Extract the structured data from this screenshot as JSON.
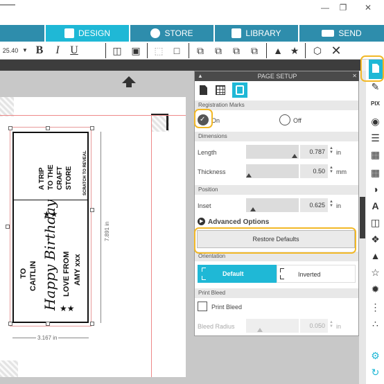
{
  "nav": {
    "tabs": [
      {
        "label": "DESIGN",
        "icon": "grid-icon",
        "active": true
      },
      {
        "label": "STORE",
        "icon": "store-icon",
        "active": false
      },
      {
        "label": "LIBRARY",
        "icon": "library-icon",
        "active": false
      },
      {
        "label": "SEND",
        "icon": "send-icon",
        "active": false
      }
    ]
  },
  "toolbar": {
    "font_size": "25.40",
    "bold": "B",
    "italic": "I",
    "underline": "U"
  },
  "panel": {
    "title": "PAGE SETUP",
    "registration_marks": {
      "section": "Registration Marks",
      "on_label": "On",
      "off_label": "Off",
      "selected": "On"
    },
    "dimensions": {
      "section": "Dimensions",
      "length_label": "Length",
      "length_value": "0.787",
      "length_unit": "in",
      "thickness_label": "Thickness",
      "thickness_value": "0.50",
      "thickness_unit": "mm"
    },
    "position": {
      "section": "Position",
      "inset_label": "Inset",
      "inset_value": "0.625",
      "inset_unit": "in"
    },
    "advanced_options": "Advanced Options",
    "restore_defaults": "Restore Defaults",
    "orientation": {
      "section": "Orientation",
      "default_label": "Default",
      "inverted_label": "Inverted",
      "selected": "Default"
    },
    "print_bleed": {
      "section": "Print Bleed",
      "checkbox_label": "Print Bleed",
      "bleed_radius_label": "Bleed Radius",
      "bleed_radius_value": "0.050",
      "bleed_radius_unit": "in"
    }
  },
  "design": {
    "ticket_lines": [
      "A TRIP",
      "TO THE",
      "CRAFT",
      "STORE"
    ],
    "scratch_text": "SCRATCH TO REVEAL",
    "to_text": "TO",
    "name_text": "CAITLIN",
    "birthday_text": "Happy Birthday",
    "love_from": "LOVE FROM",
    "signature": "AMY xxx",
    "height_dim": "7.891 in",
    "width_dim": "3.167 in"
  },
  "colors": {
    "nav_active": "#1fb8d6",
    "nav_inactive": "#2e8dac",
    "accent": "#1fb8d6",
    "highlight": "#f2b826",
    "panel_header": "#4a4a4a"
  }
}
